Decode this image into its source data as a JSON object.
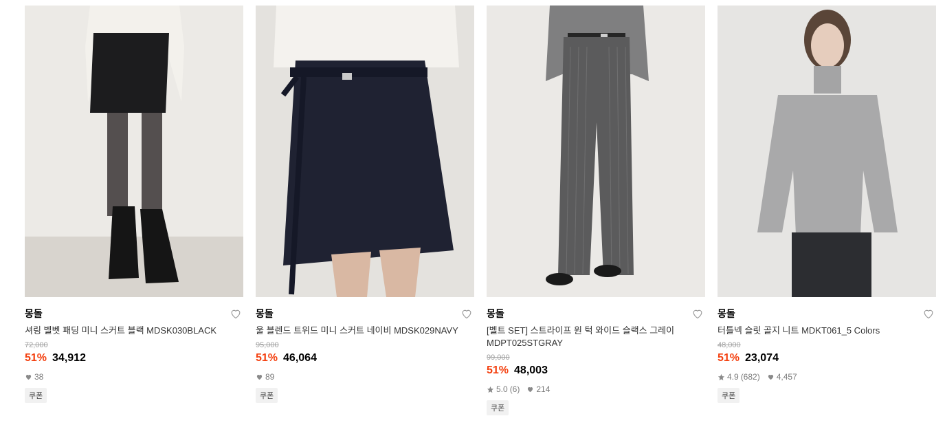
{
  "products": [
    {
      "brand": "몽돌",
      "title": "셔링 벨벳 패딩 미니 스커트 블랙 MDSK030BLACK",
      "original_price": "72,000",
      "discount": "51%",
      "price": "34,912",
      "rating": "",
      "review_count": "",
      "likes": "38",
      "coupon": "쿠폰"
    },
    {
      "brand": "몽돌",
      "title": "울 블렌드 트위드 미니 스커트 네이비 MDSK029NAVY",
      "original_price": "95,000",
      "discount": "51%",
      "price": "46,064",
      "rating": "",
      "review_count": "",
      "likes": "89",
      "coupon": "쿠폰"
    },
    {
      "brand": "몽돌",
      "title": "[벨트 SET] 스트라이프 원 턱 와이드 슬랙스 그레이 MDPT025STGRAY",
      "original_price": "99,000",
      "discount": "51%",
      "price": "48,003",
      "rating": "5.0",
      "review_count": "(6)",
      "likes": "214",
      "coupon": "쿠폰"
    },
    {
      "brand": "몽돌",
      "title": "터틀넥 슬릿 골지 니트 MDKT061_5 Colors",
      "original_price": "48,000",
      "discount": "51%",
      "price": "23,074",
      "rating": "4.9",
      "review_count": "(682)",
      "likes": "4,457",
      "coupon": "쿠폰"
    }
  ],
  "colors": {
    "discount": "#f43f0e",
    "muted": "#7a7a7a"
  },
  "icons": {
    "wishlist": "heart-outline-icon",
    "likes": "heart-filled-icon",
    "rating": "star-icon"
  }
}
